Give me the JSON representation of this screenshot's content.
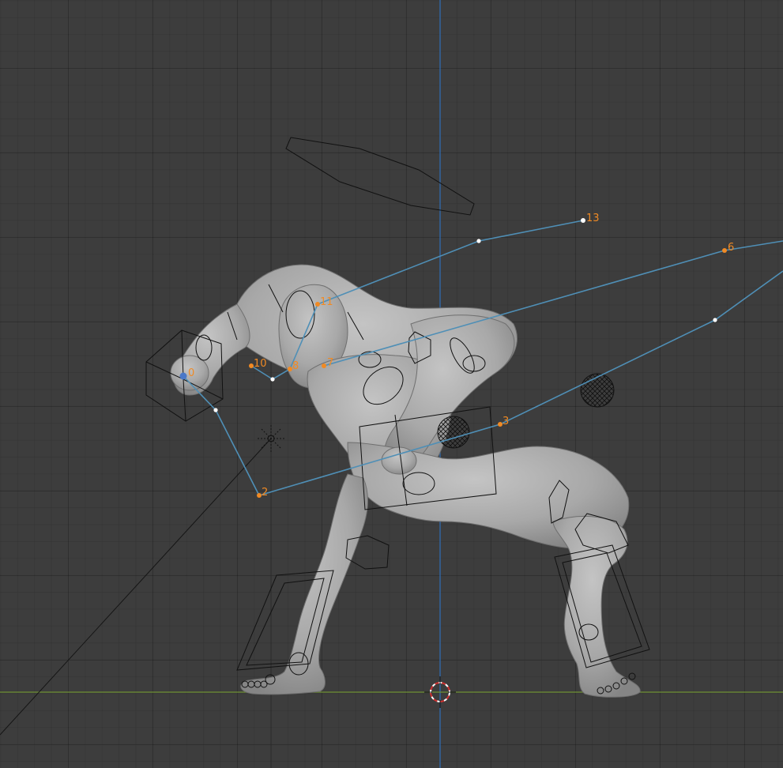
{
  "viewport": {
    "name": "3D Viewport",
    "colors": {
      "background": "#3d3d3d",
      "x_axis": "#6e8f33",
      "z_axis": "#2f6fb8",
      "path": "#4f8fb6",
      "point_label": "#f08a24",
      "mesh": "#a9a9a9",
      "wire": "#111111"
    }
  },
  "path_points": [
    {
      "label": "0",
      "kind": "active"
    },
    {
      "label": "2",
      "kind": "selected"
    },
    {
      "label": "3",
      "kind": "selected"
    },
    {
      "label": "6",
      "kind": "selected"
    },
    {
      "label": "7",
      "kind": "selected"
    },
    {
      "label": "8",
      "kind": "selected"
    },
    {
      "label": "10",
      "kind": "selected"
    },
    {
      "label": "11",
      "kind": "selected"
    },
    {
      "label": "13",
      "kind": "selected"
    }
  ],
  "objects": {
    "character": "character-mesh",
    "armature": "armature-bone-shapes",
    "empty": "empty-light",
    "cursor": "3d-cursor"
  }
}
